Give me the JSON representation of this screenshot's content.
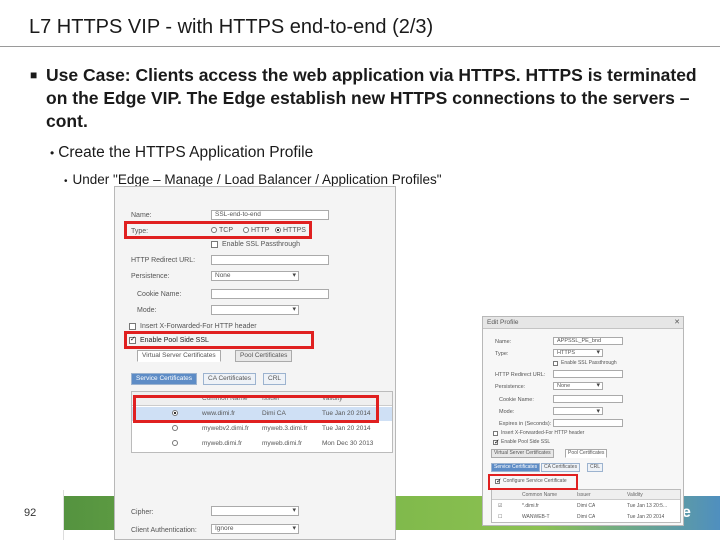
{
  "slide": {
    "title": "L7 HTTPS VIP - with HTTPS end-to-end (2/3)",
    "bullet1": "Use Case: Clients access the web application via HTTPS. HTTPS is terminated on the Edge VIP. The Edge establish new HTTPS connections to the servers – cont.",
    "bullet2": "Create the HTTPS Application Profile",
    "bullet3": "Under \"Edge – Manage / Load Balancer / Application Profiles\"",
    "page_number": "92",
    "brand_tail": "e"
  },
  "colors": {
    "highlight": "#e02020",
    "selected_row": "#cfe0f5",
    "subtab_active": "#5d8cc6"
  },
  "dialog_left": {
    "name_label": "Name:",
    "name_value": "SSL-end-to-end",
    "type_label": "Type:",
    "type_options": [
      "TCP",
      "HTTP",
      "HTTPS"
    ],
    "type_selected": "HTTPS",
    "passthrough_label": "Enable SSL Passthrough",
    "redirect_label": "HTTP Redirect URL:",
    "persistence_label": "Persistence:",
    "persistence_value": "None",
    "cookie_label": "Cookie Name:",
    "mode_label": "Mode:",
    "insert_xff_label": "Insert X-Forwarded-For HTTP header",
    "pool_ssl_label": "Enable Pool Side SSL",
    "tabs": [
      "Virtual Server Certificates",
      "Pool Certificates"
    ],
    "subtabs": [
      "Service Certificates",
      "CA Certificates",
      "CRL"
    ],
    "columns": [
      "Common Name",
      "Issuer",
      "Validity"
    ],
    "rows": [
      {
        "name": "www.dimi.fr",
        "issuer": "Dimi CA",
        "validity": "Tue Jan 20 2014"
      },
      {
        "name": "mywebv2.dimi.fr",
        "issuer": "myweb.3.dimi.fr",
        "validity": "Tue Jan 20 2014"
      },
      {
        "name": "myweb.dimi.fr",
        "issuer": "myweb.dimi.fr",
        "validity": "Mon Dec 30 2013"
      }
    ],
    "cipher_label": "Cipher:",
    "client_auth_label": "Client Authentication:",
    "client_auth_value": "Ignore"
  },
  "dialog_right": {
    "window_title": "Edit Profile",
    "name_label": "Name:",
    "name_value": "APPSSL_PE_bnd",
    "type_label": "Type:",
    "type_value": "HTTPS",
    "passthrough_label": "Enable SSL Passthrough",
    "redirect_label": "HTTP Redirect URL:",
    "persistence_label": "Persistence:",
    "persistence_value": "None",
    "cookie_label": "Cookie Name:",
    "mode_label": "Mode:",
    "expires_label": "Expires in (Seconds):",
    "insert_xff_label": "Insert X-Forwarded-For HTTP header",
    "pool_ssl_label": "Enable Pool Side SSL",
    "tabs": [
      "Virtual Server Certificates",
      "Pool Certificates"
    ],
    "subtabs": [
      "Service Certificates",
      "CA Certificates",
      "CRL"
    ],
    "configure_label": "Configure Service Certificate",
    "columns": [
      "Common Name",
      "Issuer",
      "Validity"
    ],
    "rows": [
      {
        "name": "*.dimi.fr",
        "issuer": "Dimi CA",
        "validity": "Tue Jan 13 20:5..."
      },
      {
        "name": "WANWEB-T",
        "issuer": "Dimi CA",
        "validity": "Tue Jan 20 2014"
      }
    ]
  }
}
